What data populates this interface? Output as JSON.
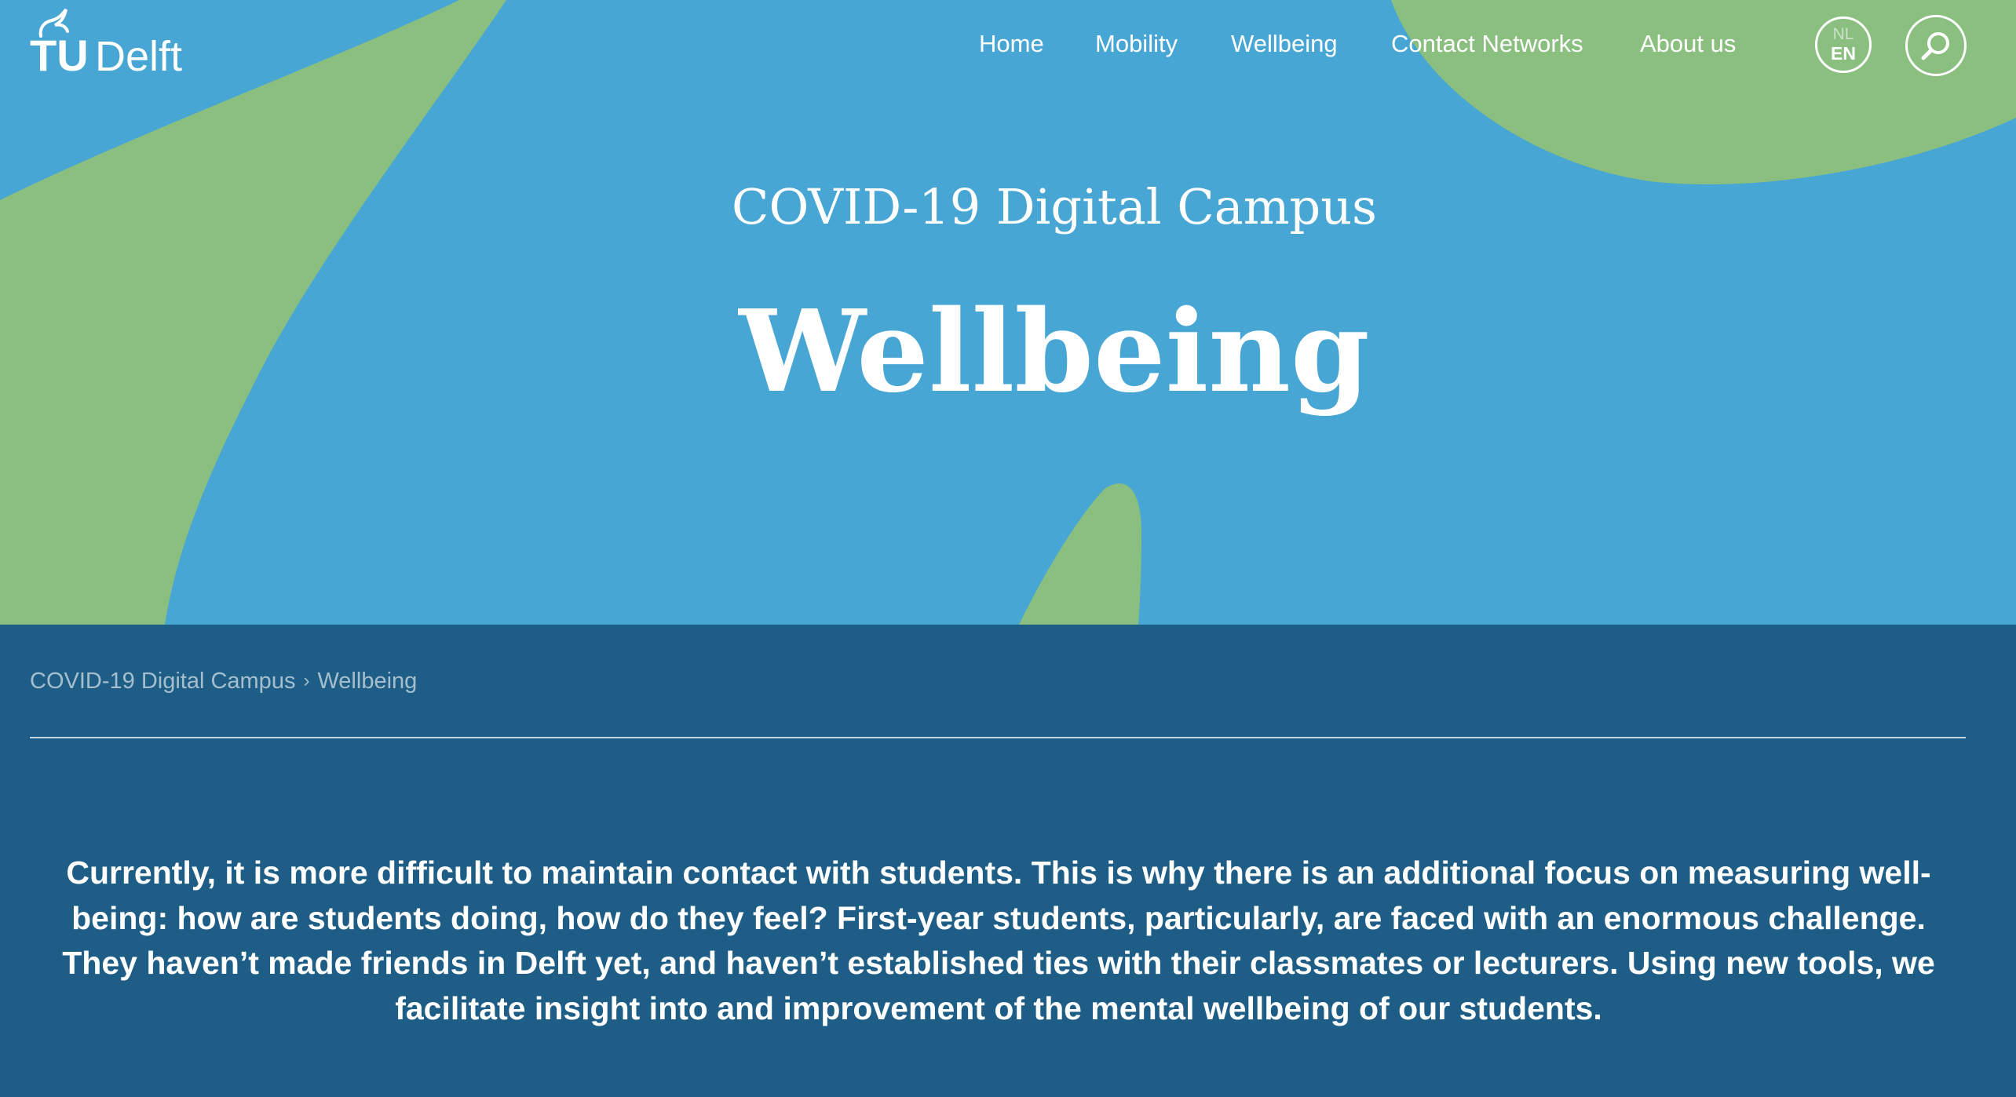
{
  "brand": {
    "logo_text_bold": "TU",
    "logo_text": "Delft",
    "colors": {
      "hero_blue": "#47a6d3",
      "shape_green": "#8bbf80",
      "content_navy": "#1e5e86",
      "text": "#ffffff"
    }
  },
  "nav": {
    "items": [
      {
        "label": "Home"
      },
      {
        "label": "Mobility"
      },
      {
        "label": "Wellbeing"
      },
      {
        "label": "Contact Networks"
      },
      {
        "label": "About us"
      }
    ],
    "language": {
      "inactive": "NL",
      "active": "EN"
    },
    "search_icon": "search-icon"
  },
  "hero": {
    "subtitle": "COVID-19 Digital Campus",
    "title": "Wellbeing"
  },
  "breadcrumb": {
    "items": [
      "COVID-19 Digital Campus",
      "Wellbeing"
    ],
    "separator_icon": "chevron-right-icon"
  },
  "content": {
    "intro": "Currently, it is more difficult to maintain contact with students. This is why there is an additional focus on measuring well-being: how are students doing, how do they feel? First-year students, particularly, are faced with an enormous challenge. They haven’t made friends in Delft yet, and haven’t established ties with their classmates or lecturers. Using new tools, we facilitate insight into and improvement of the mental wellbeing of our students."
  }
}
